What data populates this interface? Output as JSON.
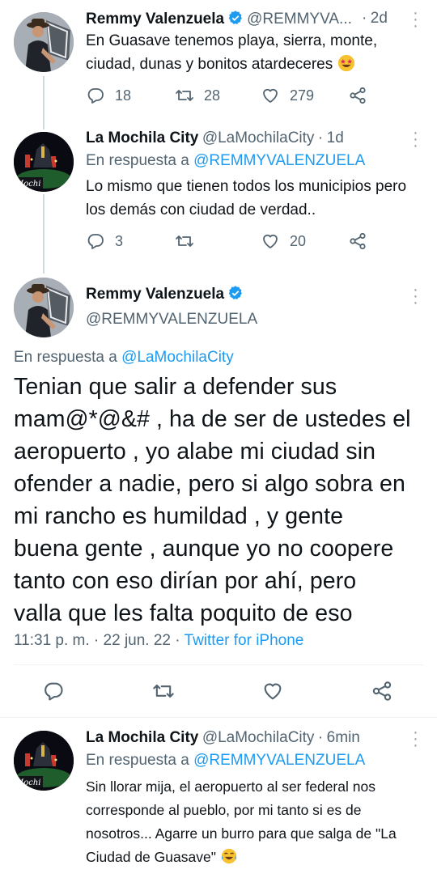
{
  "tweets": [
    {
      "name": "Remmy Valenzuela",
      "handle": "@REMMYVA...",
      "separator": "·",
      "time": "2d",
      "text": "En Guasave tenemos playa, sierra, monte, ciudad, dunas y bonitos atardeceres",
      "emoji": "star-struck",
      "replies": "18",
      "retweets": "28",
      "likes": "279"
    },
    {
      "name": "La Mochila City",
      "handle": "@LaMochilaCity",
      "separator": "·",
      "time": "1d",
      "reply_prefix": "En respuesta a",
      "reply_to": "@REMMYVALENZUELA",
      "text": "Lo mismo que tienen todos los municipios pero los demás con ciudad de verdad..",
      "replies": "3",
      "retweets": "",
      "likes": "20",
      "avatar_text": "Mochi"
    },
    {
      "name": "Remmy Valenzuela",
      "handle": "@REMMYVALENZUELA",
      "reply_prefix": "En respuesta a",
      "reply_to": "@LaMochilaCity",
      "lines": [
        "Tenian que salir a defender sus",
        "mam@*@&# , ha de ser de ustedes el",
        "aeropuerto , yo alabe mi ciudad sin",
        "ofender a nadie, pero si algo sobra en",
        "mi rancho es humildad , y gente",
        "buena gente , aunque yo no coopere",
        "tanto con eso dirían por ahí, pero",
        "valla que les falta poquito de eso"
      ],
      "timestamp": "11:31 p. m. · 22 jun. 22 · ",
      "source": "Twitter for iPhone"
    },
    {
      "name": "La Mochila City",
      "handle": "@LaMochilaCity",
      "separator": "·",
      "time": "6min",
      "reply_prefix": "En respuesta a",
      "reply_to": "@REMMYVALENZUELA",
      "text": "Sin llorar mija, el aeropuerto al ser federal nos corresponde al pueblo, por mi tanto si es de nosotros... Agarre un burro para que salga de \"La Ciudad de Guasave\"",
      "emoji": "tears-of-joy",
      "avatar_text": "Mochi"
    }
  ],
  "colors": {
    "link": "#1d9bf0",
    "muted": "#536471",
    "text": "#0f1419",
    "verified": "#1d9bf0"
  },
  "icons": [
    "reply-icon",
    "retweet-icon",
    "like-icon",
    "share-icon",
    "verified-icon",
    "more-icon"
  ]
}
